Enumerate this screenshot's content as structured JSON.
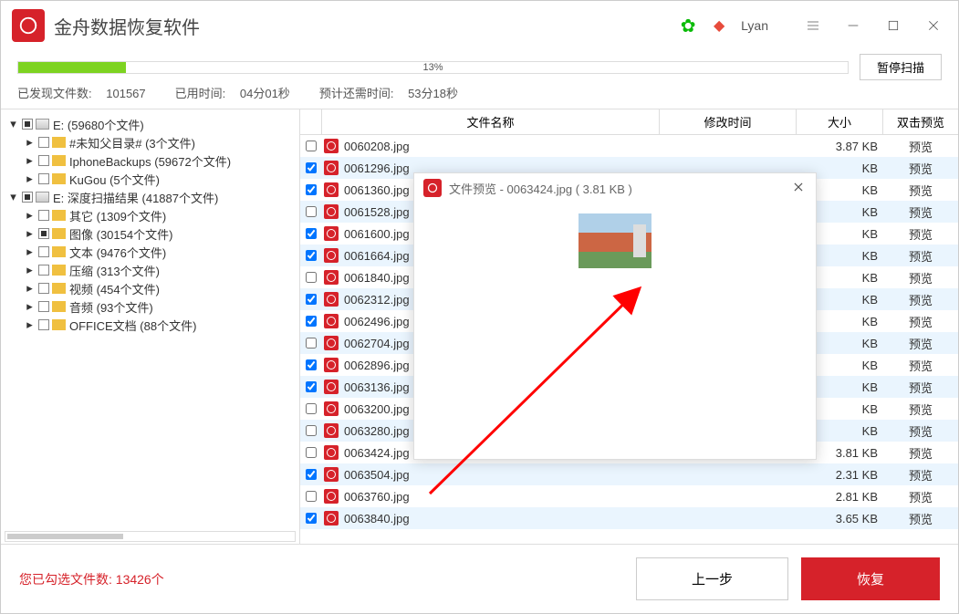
{
  "app": {
    "title": "金舟数据恢复软件",
    "user": "Lyan"
  },
  "progress": {
    "percent": 13,
    "pauseLabel": "暂停扫描",
    "foundLabel": "已发现文件数:",
    "foundCount": "101567",
    "elapsedLabel": "已用时间:",
    "elapsed": "04分01秒",
    "remainingLabel": "预计还需时间:",
    "remaining": "53分18秒"
  },
  "tree": [
    {
      "level": 0,
      "expander": "down",
      "check": "partial",
      "icon": "drive",
      "label": "E:  (59680个文件)"
    },
    {
      "level": 1,
      "expander": "right",
      "check": "empty",
      "icon": "folder",
      "label": "#未知父目录#  (3个文件)"
    },
    {
      "level": 1,
      "expander": "right",
      "check": "empty",
      "icon": "folder",
      "label": "IphoneBackups  (59672个文件)"
    },
    {
      "level": 1,
      "expander": "right",
      "check": "empty",
      "icon": "folder",
      "label": "KuGou  (5个文件)"
    },
    {
      "level": 0,
      "expander": "down",
      "check": "partial",
      "icon": "drive",
      "label": "E: 深度扫描结果  (41887个文件)"
    },
    {
      "level": 1,
      "expander": "right",
      "check": "empty",
      "icon": "folder",
      "label": "其它  (1309个文件)"
    },
    {
      "level": 1,
      "expander": "right",
      "check": "partial",
      "icon": "folder",
      "label": "图像  (30154个文件)"
    },
    {
      "level": 1,
      "expander": "right",
      "check": "empty",
      "icon": "folder",
      "label": "文本  (9476个文件)"
    },
    {
      "level": 1,
      "expander": "right",
      "check": "empty",
      "icon": "folder",
      "label": "压缩  (313个文件)"
    },
    {
      "level": 1,
      "expander": "right",
      "check": "empty",
      "icon": "folder",
      "label": "视频  (454个文件)"
    },
    {
      "level": 1,
      "expander": "right",
      "check": "empty",
      "icon": "folder",
      "label": "音频  (93个文件)"
    },
    {
      "level": 1,
      "expander": "right",
      "check": "empty",
      "icon": "folder",
      "label": "OFFICE文档  (88个文件)"
    }
  ],
  "columns": {
    "name": "文件名称",
    "date": "修改时间",
    "size": "大小",
    "preview": "双击预览"
  },
  "previewLabel": "预览",
  "files": [
    {
      "checked": false,
      "name": "0060208.jpg",
      "size": "3.87 KB"
    },
    {
      "checked": true,
      "name": "0061296.jpg",
      "size": "KB"
    },
    {
      "checked": true,
      "name": "0061360.jpg",
      "size": "KB"
    },
    {
      "checked": false,
      "name": "0061528.jpg",
      "size": "KB"
    },
    {
      "checked": true,
      "name": "0061600.jpg",
      "size": "KB"
    },
    {
      "checked": true,
      "name": "0061664.jpg",
      "size": "KB"
    },
    {
      "checked": false,
      "name": "0061840.jpg",
      "size": "KB"
    },
    {
      "checked": true,
      "name": "0062312.jpg",
      "size": "KB"
    },
    {
      "checked": true,
      "name": "0062496.jpg",
      "size": "KB"
    },
    {
      "checked": false,
      "name": "0062704.jpg",
      "size": "KB"
    },
    {
      "checked": true,
      "name": "0062896.jpg",
      "size": "KB"
    },
    {
      "checked": true,
      "name": "0063136.jpg",
      "size": "KB"
    },
    {
      "checked": false,
      "name": "0063200.jpg",
      "size": "KB"
    },
    {
      "checked": false,
      "name": "0063280.jpg",
      "size": "KB"
    },
    {
      "checked": false,
      "name": "0063424.jpg",
      "size": "3.81 KB"
    },
    {
      "checked": true,
      "name": "0063504.jpg",
      "size": "2.31 KB"
    },
    {
      "checked": false,
      "name": "0063760.jpg",
      "size": "2.81 KB"
    },
    {
      "checked": true,
      "name": "0063840.jpg",
      "size": "3.65 KB"
    }
  ],
  "footer": {
    "selectedLabel": "您已勾选文件数:",
    "selectedCount": "13426个",
    "backLabel": "上一步",
    "recoverLabel": "恢复"
  },
  "preview": {
    "title": "文件预览 - 0063424.jpg ( 3.81 KB )"
  }
}
